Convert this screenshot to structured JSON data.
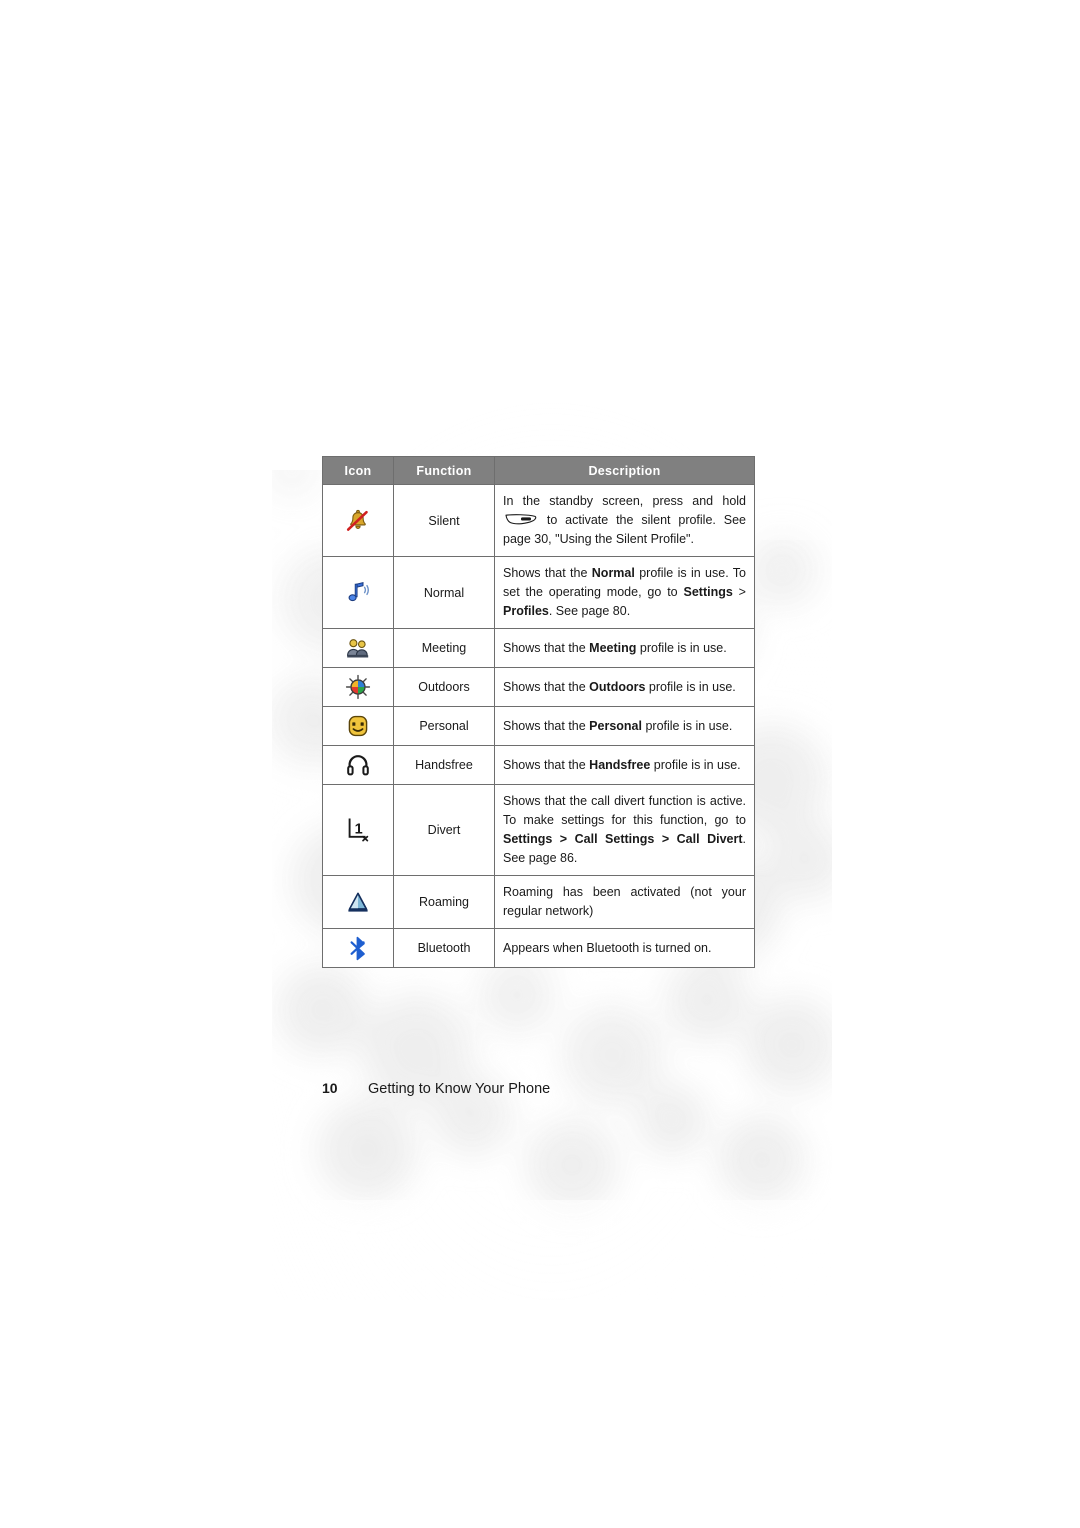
{
  "page": {
    "footer_page_number": "10",
    "footer_title": "Getting to Know Your Phone"
  },
  "table": {
    "headers": {
      "icon": "Icon",
      "function": "Function",
      "description": "Description"
    },
    "header_bg": "#808080",
    "header_text_color": "#ffffff",
    "border_color": "#6e6e6e",
    "rows": [
      {
        "icon_name": "silent-bell-muted-icon",
        "function": "Silent",
        "description_pre": "In the standby screen, press and hold ",
        "description_post": " to activate the silent profile. See page 30, \"Using the Silent Profile\"."
      },
      {
        "icon_name": "normal-music-note-icon",
        "function": "Normal",
        "desc_parts": [
          {
            "t": "Shows that the ",
            "b": false
          },
          {
            "t": "Normal",
            "b": true
          },
          {
            "t": " profile is in use. To set the operating mode, go to ",
            "b": false
          },
          {
            "t": "Settings",
            "b": true
          },
          {
            "t": " > ",
            "b": false
          },
          {
            "t": "Profiles",
            "b": true
          },
          {
            "t": ". See page 80.",
            "b": false
          }
        ]
      },
      {
        "icon_name": "meeting-people-icon",
        "function": "Meeting",
        "desc_parts": [
          {
            "t": "Shows that the ",
            "b": false
          },
          {
            "t": "Meeting",
            "b": true
          },
          {
            "t": " profile is in use.",
            "b": false
          }
        ]
      },
      {
        "icon_name": "outdoors-sun-icon",
        "function": "Outdoors",
        "desc_parts": [
          {
            "t": "Shows that the ",
            "b": false
          },
          {
            "t": "Outdoors",
            "b": true
          },
          {
            "t": " profile is in use.",
            "b": false
          }
        ]
      },
      {
        "icon_name": "personal-smiley-face-icon",
        "function": "Personal",
        "desc_parts": [
          {
            "t": "Shows that the ",
            "b": false
          },
          {
            "t": "Personal",
            "b": true
          },
          {
            "t": " profile is in use.",
            "b": false
          }
        ]
      },
      {
        "icon_name": "handsfree-headset-icon",
        "function": "Handsfree",
        "desc_parts": [
          {
            "t": "Shows that the ",
            "b": false
          },
          {
            "t": "Handsfree",
            "b": true
          },
          {
            "t": " profile is in use.",
            "b": false
          }
        ]
      },
      {
        "icon_name": "divert-call-arrow-icon",
        "function": "Divert",
        "desc_parts": [
          {
            "t": "Shows that the call divert function is active. To make settings for this function, go to ",
            "b": false
          },
          {
            "t": "Settings > Call Settings > Call Divert",
            "b": true
          },
          {
            "t": ". See page 86.",
            "b": false
          }
        ]
      },
      {
        "icon_name": "roaming-triangle-icon",
        "function": "Roaming",
        "desc_parts": [
          {
            "t": "Roaming has been activated (not your regular network)",
            "b": false
          }
        ]
      },
      {
        "icon_name": "bluetooth-icon",
        "function": "Bluetooth",
        "desc_parts": [
          {
            "t": "Appears when Bluetooth is turned on.",
            "b": false
          }
        ]
      }
    ]
  },
  "colors": {
    "text": "#1a1a1a",
    "bluetooth_blue": "#1f5fd0",
    "roaming_blue": "#7fb8d8",
    "smiley_gold": "#f0c43c",
    "bell_gold": "#d8a828",
    "slash_red": "#d02020"
  }
}
